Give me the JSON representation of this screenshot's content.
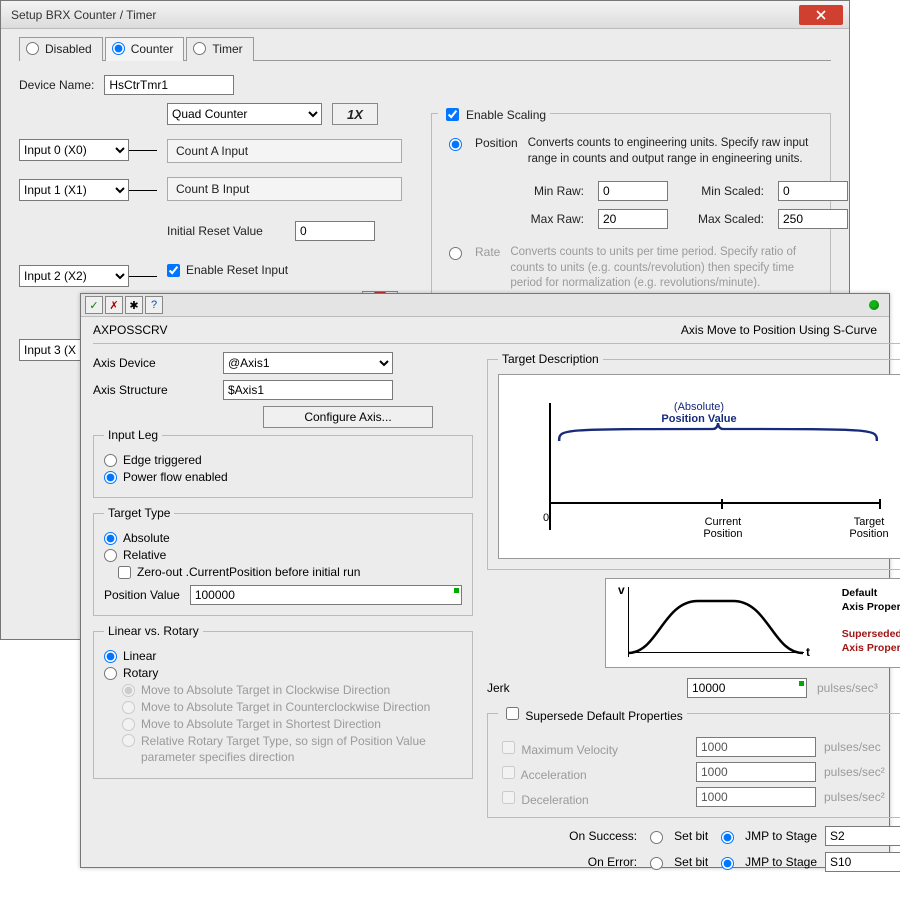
{
  "win1": {
    "title": "Setup BRX Counter / Timer",
    "tabs": {
      "disabled": "Disabled",
      "counter": "Counter",
      "timer": "Timer"
    },
    "device_name_label": "Device Name:",
    "device_name": "HsCtrTmr1",
    "func_sel": "Quad Counter",
    "btn1x": "1X",
    "input0": "Input 0 (X0)",
    "input1": "Input 1 (X1)",
    "input2": "Input 2 (X2)",
    "input3": "Input 3 (X",
    "countA": "Count A Input",
    "countB": "Count B Input",
    "initial_reset_label": "Initial Reset Value",
    "initial_reset_val": "0",
    "enable_reset": "Enable Reset Input",
    "scaling": {
      "legend": "Enable Scaling",
      "pos_label": "Position",
      "pos_desc": "Converts counts to engineering units. Specify raw input range in counts and output range in engineering units.",
      "min_raw_l": "Min Raw:",
      "min_raw": "0",
      "max_raw_l": "Max Raw:",
      "max_raw": "20",
      "min_sc_l": "Min Scaled:",
      "min_sc": "0",
      "max_sc_l": "Max Scaled:",
      "max_sc": "250",
      "rate_label": "Rate",
      "rate_desc": "Converts counts to units per time period. Specify ratio of counts to units (e.g. counts/revolution) then specify time period for normalization (e.g. revolutions/minute)."
    }
  },
  "win2": {
    "name": "AXPOSSCRV",
    "subtitle": "Axis Move to Position Using S-Curve",
    "toolbar": {
      "ok": "✓",
      "cancel": "✗",
      "settings": "✱",
      "help": "?"
    },
    "axis_device_l": "Axis Device",
    "axis_device": "@Axis1",
    "axis_struct_l": "Axis Structure",
    "axis_struct": "$Axis1",
    "configure": "Configure Axis...",
    "inputleg": {
      "legend": "Input Leg",
      "edge": "Edge triggered",
      "power": "Power flow enabled"
    },
    "targettype": {
      "legend": "Target Type",
      "abs": "Absolute",
      "rel": "Relative",
      "zero": "Zero-out .CurrentPosition before initial run",
      "posval_l": "Position Value",
      "posval": "100000"
    },
    "linrot": {
      "legend": "Linear vs. Rotary",
      "lin": "Linear",
      "rot": "Rotary",
      "cw": "Move to Absolute Target in Clockwise Direction",
      "ccw": "Move to Absolute Target in Counterclockwise Direction",
      "short": "Move to Absolute Target in Shortest Direction",
      "relrot": "Relative Rotary Target Type, so sign of Position Value parameter specifies direction"
    },
    "target_desc_legend": "Target Description",
    "diagram": {
      "absL": "(Absolute)",
      "posvalL": "Position Value",
      "zero": "0",
      "cur1": "Current",
      "cur2": "Position",
      "tgt1": "Target",
      "tgt2": "Position"
    },
    "velplot": {
      "v": "v",
      "t": "t",
      "def1": "Default",
      "def2": "Axis Property",
      "sup1": "Superseded",
      "sup2": "Axis Property"
    },
    "jerk_l": "Jerk",
    "jerk": "10000",
    "jerk_u": "pulses/sec³",
    "supersede": {
      "legend": "Supersede Default Properties",
      "maxv": "Maximum Velocity",
      "maxv_v": "1000",
      "maxv_u": "pulses/sec",
      "acc": "Acceleration",
      "acc_v": "1000",
      "acc_u": "pulses/sec²",
      "dec": "Deceleration",
      "dec_v": "1000",
      "dec_u": "pulses/sec²"
    },
    "onsuccess_l": "On Success:",
    "onerror_l": "On Error:",
    "setbit": "Set bit",
    "jmp": "JMP to Stage",
    "succ_stage": "S2",
    "err_stage": "S10"
  }
}
